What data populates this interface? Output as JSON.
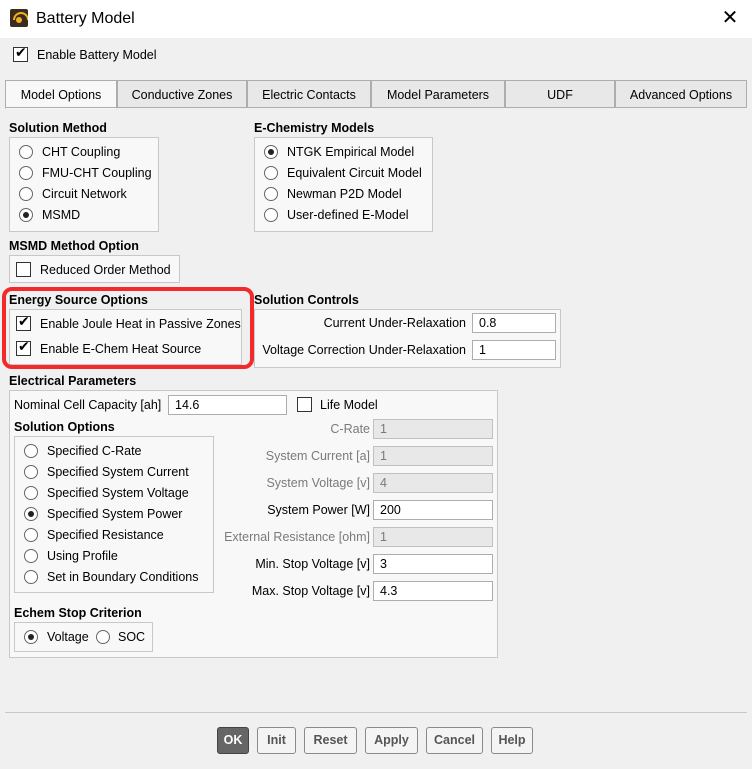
{
  "window": {
    "title": "Battery Model",
    "close_glyph": "✕"
  },
  "enable_battery_model": {
    "label": "Enable Battery Model",
    "checked": true
  },
  "tabs": [
    {
      "label": "Model Options",
      "active": true
    },
    {
      "label": "Conductive Zones",
      "active": false
    },
    {
      "label": "Electric Contacts",
      "active": false
    },
    {
      "label": "Model Parameters",
      "active": false
    },
    {
      "label": "UDF",
      "active": false
    },
    {
      "label": "Advanced Options",
      "active": false
    }
  ],
  "solution_method": {
    "title": "Solution Method",
    "options": [
      {
        "label": "CHT Coupling",
        "selected": false
      },
      {
        "label": "FMU-CHT Coupling",
        "selected": false
      },
      {
        "label": "Circuit Network",
        "selected": false
      },
      {
        "label": "MSMD",
        "selected": true
      }
    ]
  },
  "echem_models": {
    "title": "E-Chemistry Models",
    "options": [
      {
        "label": "NTGK Empirical Model",
        "selected": true
      },
      {
        "label": "Equivalent Circuit Model",
        "selected": false
      },
      {
        "label": "Newman P2D Model",
        "selected": false
      },
      {
        "label": "User-defined E-Model",
        "selected": false
      }
    ]
  },
  "msmd_option": {
    "title": "MSMD Method Option",
    "reduced_order": {
      "label": "Reduced Order Method",
      "checked": false
    }
  },
  "energy_source": {
    "title": "Energy Source Options",
    "joule": {
      "label": "Enable Joule Heat in Passive Zones",
      "checked": true
    },
    "echem_heat": {
      "label": "Enable E-Chem Heat Source",
      "checked": true
    }
  },
  "solution_controls": {
    "title": "Solution Controls",
    "current_label": "Current Under-Relaxation",
    "current_value": "0.8",
    "voltage_label": "Voltage Correction Under-Relaxation",
    "voltage_value": "1"
  },
  "electrical": {
    "title": "Electrical Parameters",
    "capacity_label": "Nominal Cell Capacity [ah]",
    "capacity_value": "14.6",
    "life_model": {
      "label": "Life Model",
      "checked": false
    },
    "solution_options_title": "Solution Options",
    "solution_options": [
      {
        "label": "Specified C-Rate",
        "selected": false
      },
      {
        "label": "Specified System Current",
        "selected": false
      },
      {
        "label": "Specified System Voltage",
        "selected": false
      },
      {
        "label": "Specified System Power",
        "selected": true
      },
      {
        "label": "Specified Resistance",
        "selected": false
      },
      {
        "label": "Using Profile",
        "selected": false
      },
      {
        "label": "Set in Boundary Conditions",
        "selected": false
      }
    ],
    "params": [
      {
        "label": "C-Rate",
        "value": "1",
        "disabled": true
      },
      {
        "label": "System Current [a]",
        "value": "1",
        "disabled": true
      },
      {
        "label": "System Voltage [v]",
        "value": "4",
        "disabled": true
      },
      {
        "label": "System Power [W]",
        "value": "200",
        "disabled": false
      },
      {
        "label": "External Resistance [ohm]",
        "value": "1",
        "disabled": true
      },
      {
        "label": "Min. Stop Voltage [v]",
        "value": "3",
        "disabled": false
      },
      {
        "label": "Max. Stop Voltage [v]",
        "value": "4.3",
        "disabled": false
      }
    ],
    "stop_criterion_title": "Echem Stop Criterion",
    "stop_criterion": [
      {
        "label": "Voltage",
        "selected": true
      },
      {
        "label": "SOC",
        "selected": false
      }
    ]
  },
  "buttons": {
    "ok": "OK",
    "init": "Init",
    "reset": "Reset",
    "apply": "Apply",
    "cancel": "Cancel",
    "help": "Help"
  }
}
